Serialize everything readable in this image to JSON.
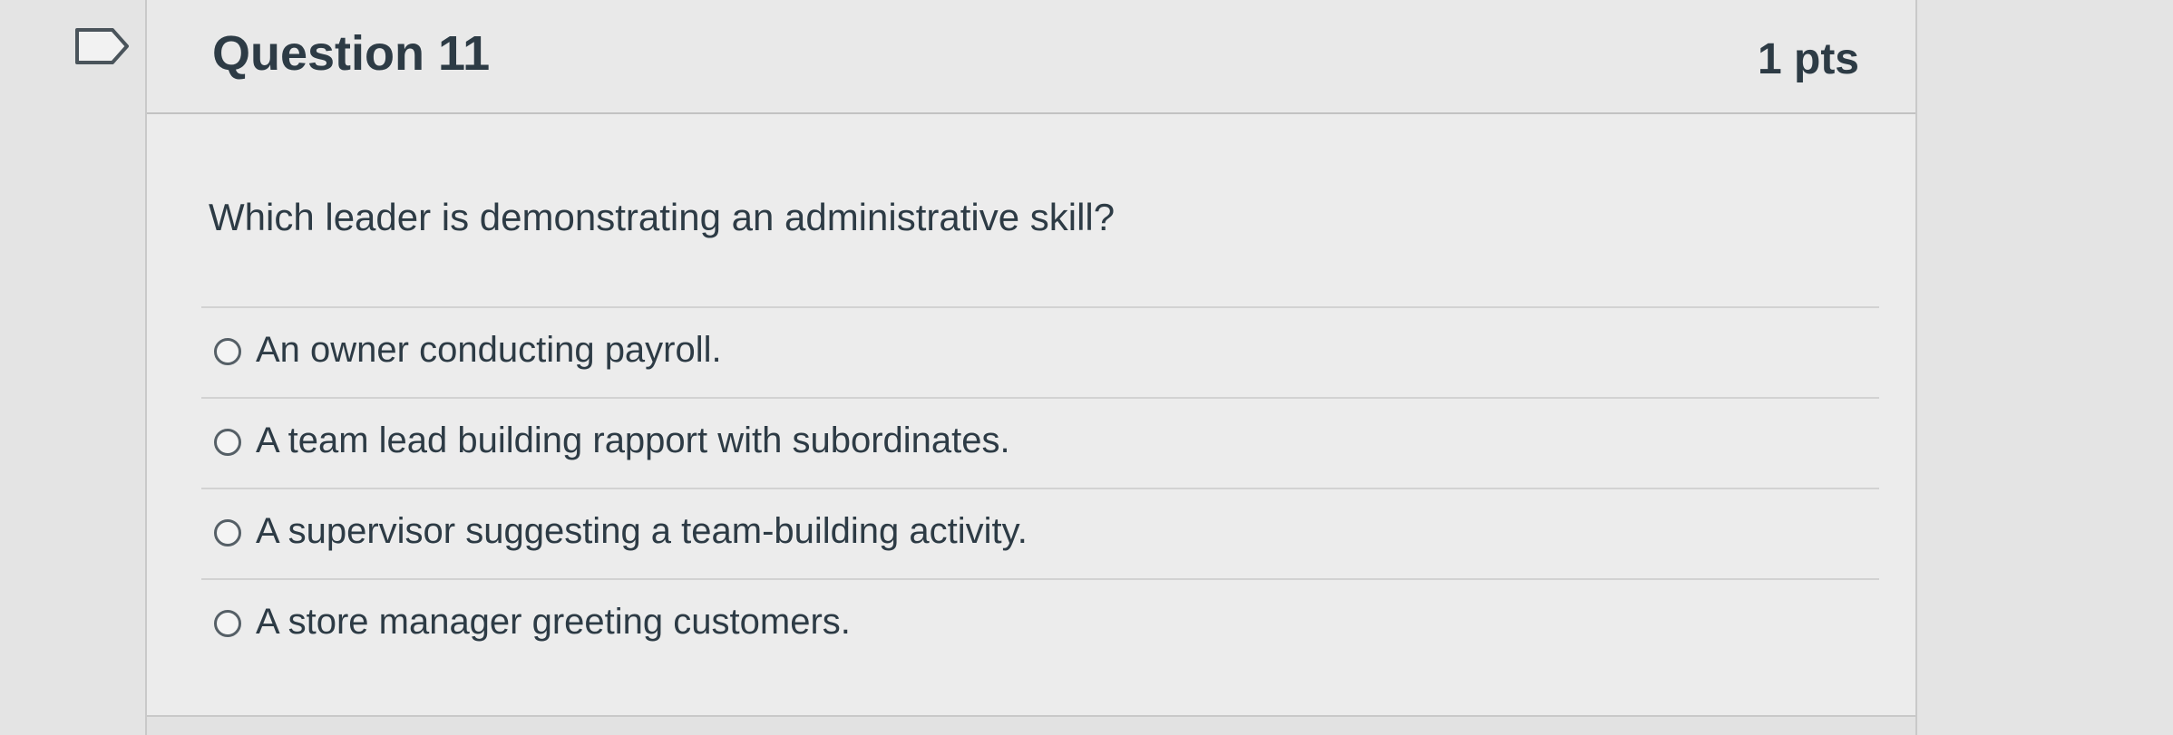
{
  "question": {
    "flag_icon": "flag-icon",
    "title": "Question 11",
    "points": "1 pts",
    "text": "Which leader is demonstrating an administrative skill?",
    "answers": [
      {
        "label": "An owner conducting payroll.",
        "selected": false
      },
      {
        "label": "A team lead building rapport with subordinates.",
        "selected": false
      },
      {
        "label": "A supervisor suggesting a team-building activity.",
        "selected": false
      },
      {
        "label": "A store manager greeting customers.",
        "selected": false
      }
    ]
  },
  "colors": {
    "page_background": "#e4e4e4",
    "card_background": "#ececec",
    "text": "#2d3b45",
    "border": "#c9c9c9"
  }
}
